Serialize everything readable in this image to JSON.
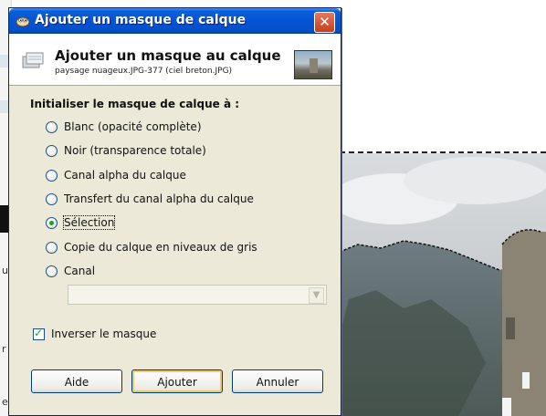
{
  "dialog": {
    "title": "Ajouter un masque de calque",
    "close_label": "✕",
    "header_title": "Ajouter un masque au calque",
    "header_subtitle": "paysage nuageux.JPG-377 (ciel breton.JPG)"
  },
  "mask_init": {
    "label": "Initialiser le masque de calque à :",
    "options": [
      {
        "label": "Blanc (opacité complète)",
        "selected": false
      },
      {
        "label": "Noir (transparence totale)",
        "selected": false
      },
      {
        "label": "Canal alpha du calque",
        "selected": false
      },
      {
        "label": "Transfert du canal alpha du calque",
        "selected": false
      },
      {
        "label": "Sélection",
        "selected": true
      },
      {
        "label": "Copie du calque en niveaux de gris",
        "selected": false
      },
      {
        "label": "Canal",
        "selected": false
      }
    ],
    "channel_combo_value": ""
  },
  "invert": {
    "label": "Inverser le masque",
    "checked": true
  },
  "buttons": {
    "help": "Aide",
    "add": "Ajouter",
    "cancel": "Annuler"
  },
  "background": {
    "left_letters": [
      "u",
      "r",
      "e"
    ]
  },
  "colors": {
    "title_bar": "#0554d4",
    "dialog_bg": "#ece9d8",
    "radio_dot": "#21a121"
  }
}
